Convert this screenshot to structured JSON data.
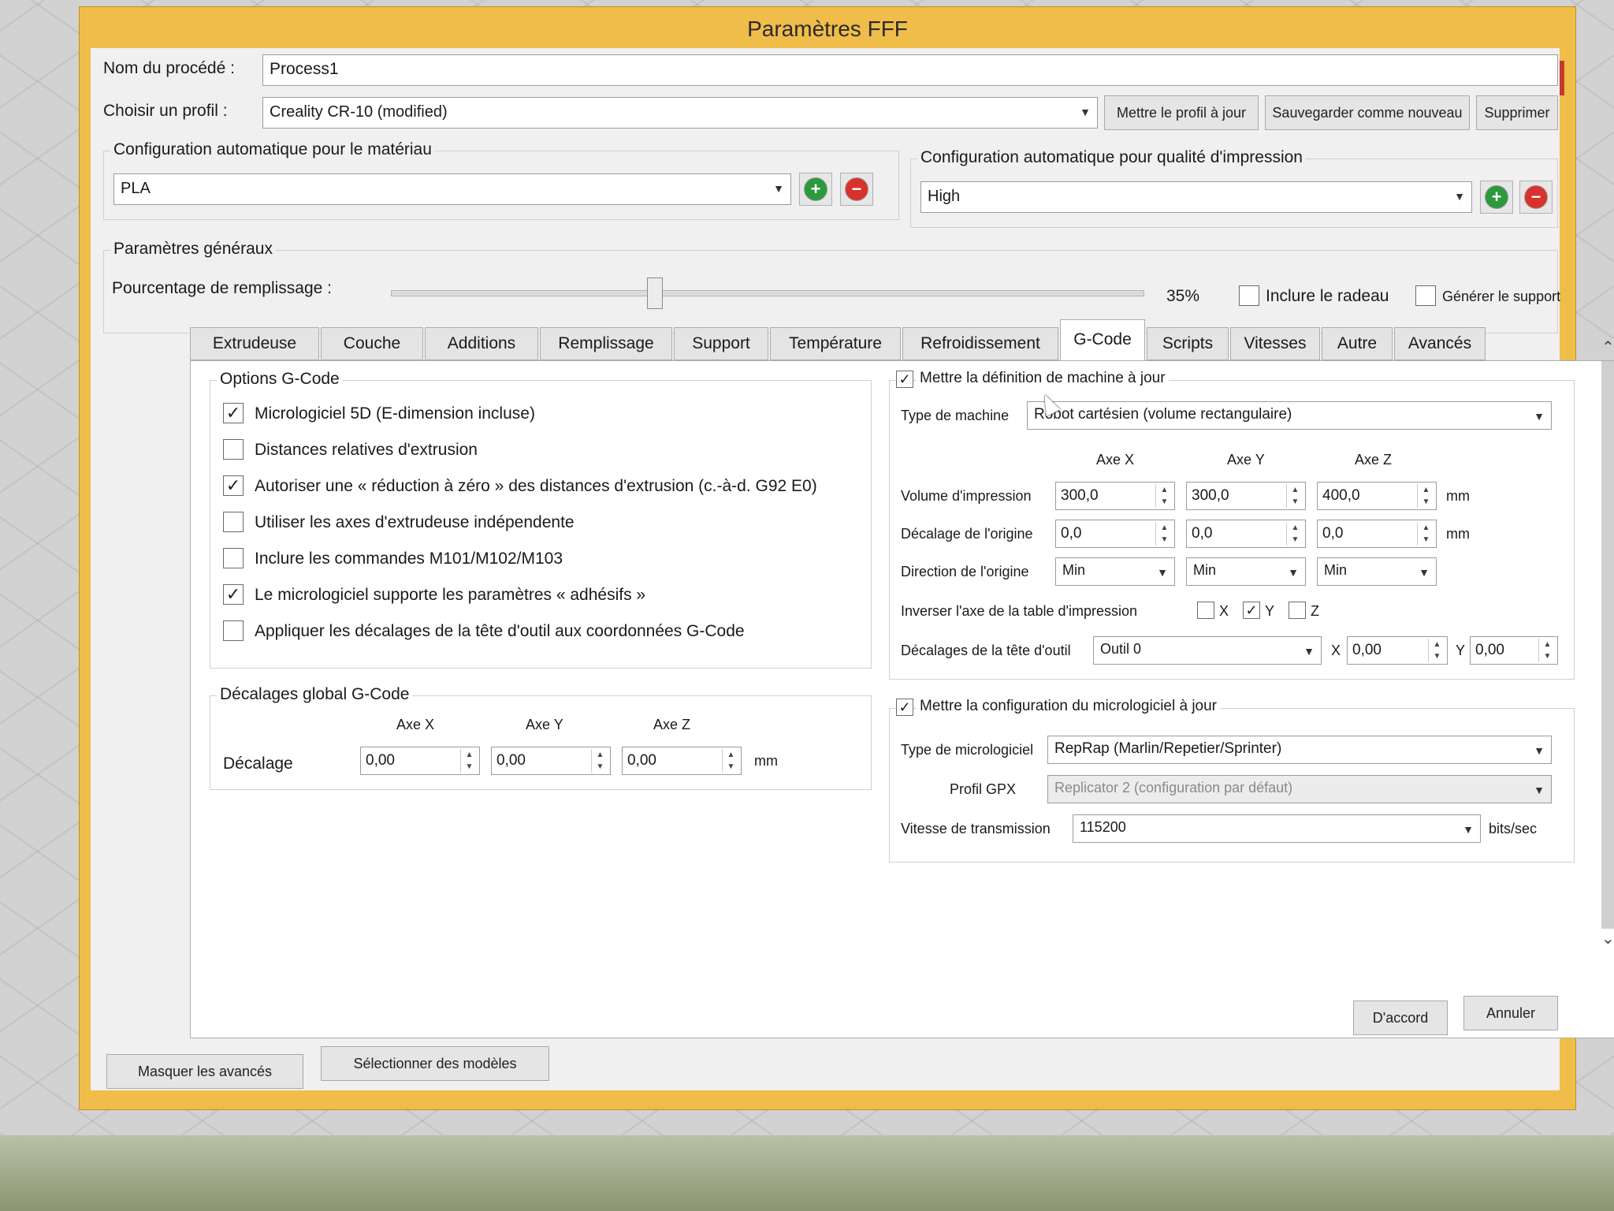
{
  "dialog": {
    "title": "Paramètres FFF",
    "help": "?",
    "close": "×",
    "process_name_label": "Nom du procédé :",
    "process_name_value": "Process1",
    "profile_label": "Choisir un profil :",
    "profile_value": "Creality CR-10 (modified)",
    "update_profile_btn": "Mettre le profil à jour",
    "save_new_btn": "Sauvegarder comme nouveau",
    "delete_btn": "Supprimer",
    "material_group": "Configuration automatique pour le matériau",
    "material_value": "PLA",
    "quality_group": "Configuration automatique pour qualité d'impression",
    "quality_value": "High",
    "general_group": "Paramètres généraux",
    "infill_label": "Pourcentage de remplissage :",
    "infill_value": "35%",
    "infill_fraction": 0.35,
    "raft_label": "Inclure le radeau",
    "support_label": "Générer le support",
    "tabs": [
      "Extrudeuse",
      "Couche",
      "Additions",
      "Remplissage",
      "Support",
      "Température",
      "Refroidissement",
      "G-Code",
      "Scripts",
      "Vitesses",
      "Autre",
      "Avancés"
    ],
    "active_tab": "G-Code",
    "hide_advanced_btn": "Masquer les avancés",
    "select_models_btn": "Sélectionner des modèles",
    "ok_btn": "D'accord",
    "cancel_btn": "Annuler"
  },
  "gcode": {
    "options_group": "Options G-Code",
    "options": [
      {
        "label": "Micrologiciel 5D (E-dimension incluse)",
        "checked": true
      },
      {
        "label": "Distances relatives d'extrusion",
        "checked": false
      },
      {
        "label": "Autoriser une « réduction à zéro » des distances d'extrusion (c.-à-d. G92 E0)",
        "checked": true
      },
      {
        "label": "Utiliser les axes d'extrudeuse indépendente",
        "checked": false
      },
      {
        "label": "Inclure les commandes M101/M102/M103",
        "checked": false
      },
      {
        "label": "Le micrologiciel supporte les paramètres « adhésifs »",
        "checked": true
      },
      {
        "label": "Appliquer les décalages de la tête d'outil aux coordonnées G-Code",
        "checked": false
      }
    ],
    "global_offsets_group": "Décalages global G-Code",
    "axis_x": "Axe X",
    "axis_y": "Axe Y",
    "axis_z": "Axe Z",
    "offset_label": "Décalage",
    "offset_x": "0,00",
    "offset_y": "0,00",
    "offset_z": "0,00",
    "mm": "mm",
    "update_machine_label": "Mettre la définition de machine à jour",
    "update_machine_checked": true,
    "machine_type_label": "Type de machine",
    "machine_type_value": "Robot cartésien (volume rectangulaire)",
    "build_volume_label": "Volume d'impression",
    "build_x": "300,0",
    "build_y": "300,0",
    "build_z": "400,0",
    "origin_offset_label": "Décalage de l'origine",
    "origin_x": "0,0",
    "origin_y": "0,0",
    "origin_z": "0,0",
    "origin_dir_label": "Direction de l'origine",
    "origin_dir_x": "Min",
    "origin_dir_y": "Min",
    "origin_dir_z": "Min",
    "invert_label": "Inverser l'axe de la table d'impression",
    "invert_x": "X",
    "invert_y": "Y",
    "invert_z": "Z",
    "invert_y_checked": true,
    "tool_offsets_label": "Décalages de la tête d'outil",
    "tool_value": "Outil 0",
    "tool_x_label": "X",
    "tool_x": "0,00",
    "tool_y_label": "Y",
    "tool_y": "0,00",
    "update_firmware_label": "Mettre la configuration du micrologiciel à jour",
    "update_firmware_checked": true,
    "firmware_type_label": "Type de micrologiciel",
    "firmware_type_value": "RepRap (Marlin/Repetier/Sprinter)",
    "gpx_label": "Profil GPX",
    "gpx_value": "Replicator 2 (configuration par défaut)",
    "baud_label": "Vitesse de transmission",
    "baud_value": "115200",
    "baud_unit": "bits/sec"
  }
}
